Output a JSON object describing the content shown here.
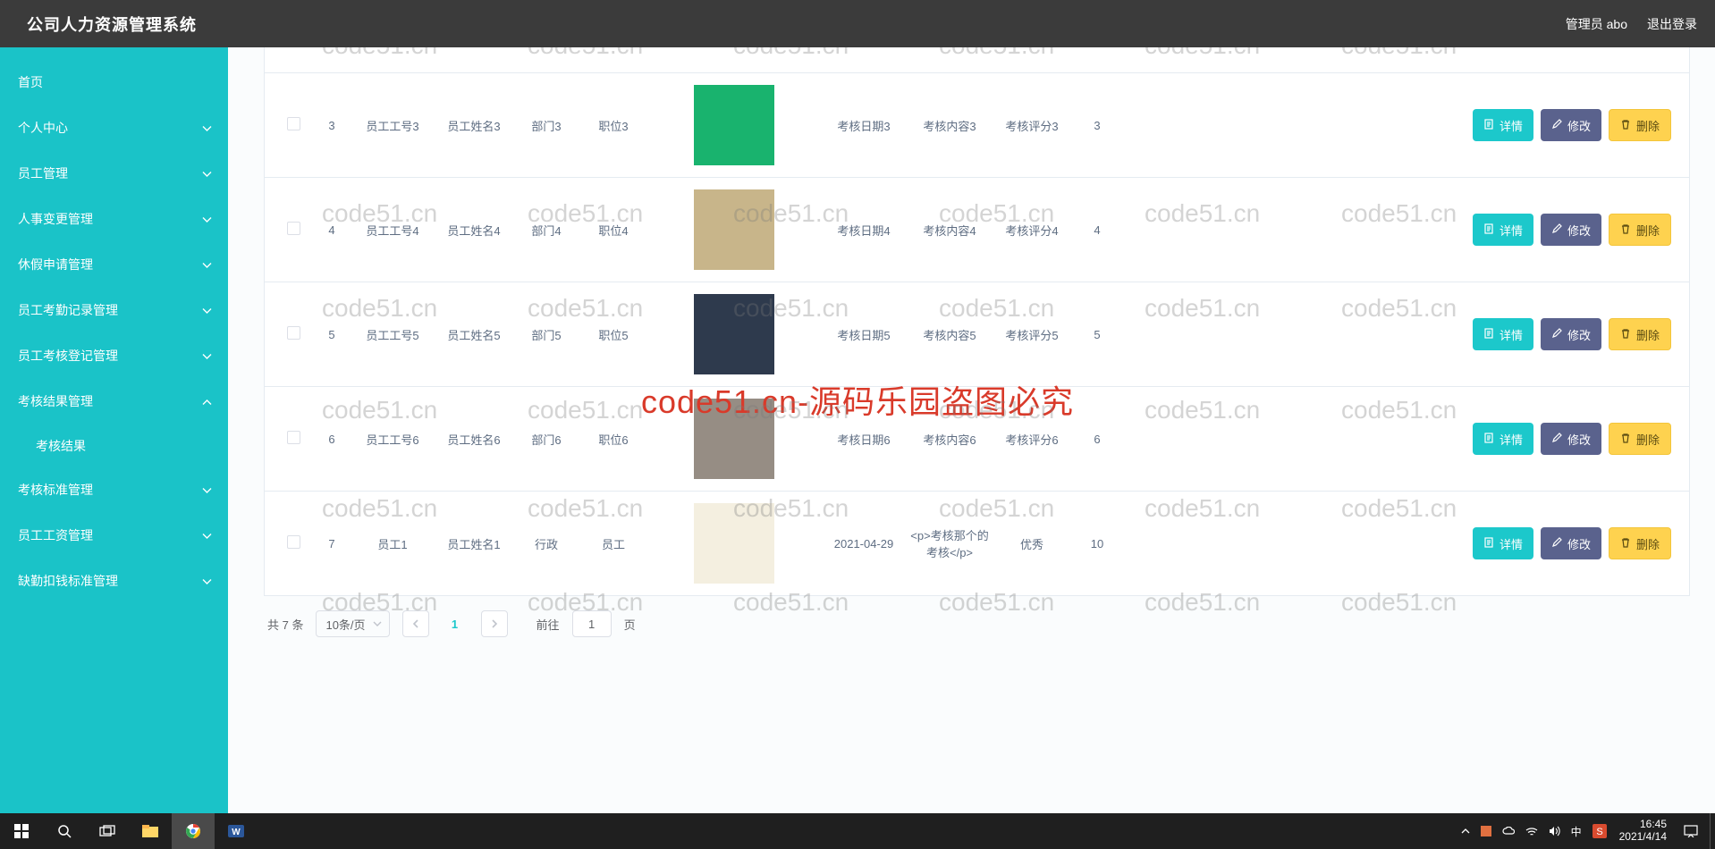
{
  "header": {
    "title": "公司人力资源管理系统",
    "user_label": "管理员 abo",
    "logout": "退出登录"
  },
  "sidebar": {
    "items": [
      {
        "label": "首页",
        "expandable": false
      },
      {
        "label": "个人中心",
        "expandable": true
      },
      {
        "label": "员工管理",
        "expandable": true
      },
      {
        "label": "人事变更管理",
        "expandable": true
      },
      {
        "label": "休假申请管理",
        "expandable": true
      },
      {
        "label": "员工考勤记录管理",
        "expandable": true
      },
      {
        "label": "员工考核登记管理",
        "expandable": true
      },
      {
        "label": "考核结果管理",
        "expandable": true,
        "open": true,
        "children": [
          {
            "label": "考核结果"
          }
        ]
      },
      {
        "label": "考核标准管理",
        "expandable": true
      },
      {
        "label": "员工工资管理",
        "expandable": true
      },
      {
        "label": "缺勤扣钱标准管理",
        "expandable": true
      }
    ]
  },
  "table": {
    "rows": [
      {
        "idx": "3",
        "emp_no": "员工工号3",
        "emp_name": "员工姓名3",
        "dept": "部门3",
        "pos": "职位3",
        "date": "考核日期3",
        "content": "考核内容3",
        "score_lbl": "考核评分3",
        "score": "3",
        "img_bg": "#19b36e"
      },
      {
        "idx": "4",
        "emp_no": "员工工号4",
        "emp_name": "员工姓名4",
        "dept": "部门4",
        "pos": "职位4",
        "date": "考核日期4",
        "content": "考核内容4",
        "score_lbl": "考核评分4",
        "score": "4",
        "img_bg": "#c8b58a"
      },
      {
        "idx": "5",
        "emp_no": "员工工号5",
        "emp_name": "员工姓名5",
        "dept": "部门5",
        "pos": "职位5",
        "date": "考核日期5",
        "content": "考核内容5",
        "score_lbl": "考核评分5",
        "score": "5",
        "img_bg": "#2e3a4d"
      },
      {
        "idx": "6",
        "emp_no": "员工工号6",
        "emp_name": "员工姓名6",
        "dept": "部门6",
        "pos": "职位6",
        "date": "考核日期6",
        "content": "考核内容6",
        "score_lbl": "考核评分6",
        "score": "6",
        "img_bg": "#968d84"
      },
      {
        "idx": "7",
        "emp_no": "员工1",
        "emp_name": "员工姓名1",
        "dept": "行政",
        "pos": "员工",
        "date": "2021-04-29",
        "content": "<p>考核那个的考核</p>",
        "score_lbl": "优秀",
        "score": "10",
        "img_bg": "#f4efe0"
      }
    ],
    "action_labels": {
      "detail": "详情",
      "edit": "修改",
      "delete": "删除"
    }
  },
  "pager": {
    "total_text": "共 7 条",
    "page_size_label": "10条/页",
    "current": "1",
    "goto_prefix": "前往",
    "goto_value": "1",
    "goto_suffix": "页"
  },
  "watermark": {
    "small": "code51.cn",
    "big": "code51.cn-源码乐园盗图必究"
  },
  "taskbar": {
    "time": "16:45",
    "date": "2021/4/14",
    "ime": "中"
  }
}
